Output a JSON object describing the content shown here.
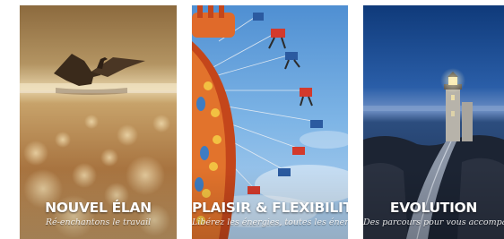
{
  "cards": [
    {
      "title": "NOUVEL ÉLAN",
      "subtitle": "Ré-enchantons le travail",
      "image": "cormorant-on-water-photo"
    },
    {
      "title": "PLAISIR & FLEXIBILITÉ",
      "subtitle": "Libérez les énergies, toutes les énergies",
      "image": "chain-swing-ride-photo"
    },
    {
      "title": "EVOLUTION",
      "subtitle": "Des parcours pour vous accompagner",
      "image": "lighthouse-causeway-photo"
    }
  ],
  "colors": {
    "title_text": "#ffffff",
    "card1_tone": "#b8884e",
    "card2_sky": "#5f9bd6",
    "card3_sea": "#1f3f73"
  }
}
